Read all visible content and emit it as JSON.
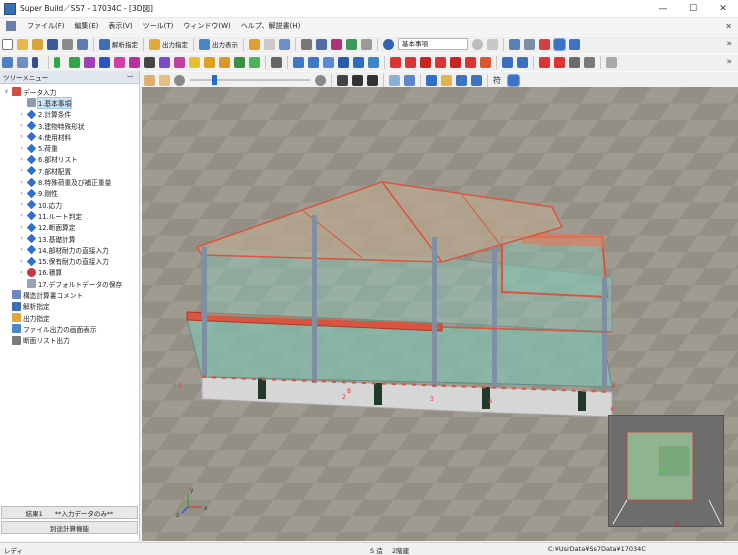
{
  "window": {
    "title": "Super Build／SS7 - 17034C - [3D図]",
    "minimize": "—",
    "maximize": "☐",
    "close": "✕"
  },
  "menu": {
    "items": [
      "ファイル(F)",
      "編集(E)",
      "表示(V)",
      "ツール(T)",
      "ウィンドウ(W)",
      "ヘルプ、解説書(H)"
    ],
    "close_mark": "✕"
  },
  "toolbar1": {
    "analysis_label": "解析指定",
    "output_spec_label": "出力指定",
    "output_view_label": "出力表示",
    "dropdown_value": "基本事項",
    "overflow": "»"
  },
  "toolbar3": {
    "text_tool": "符",
    "overflow": "»"
  },
  "tree": {
    "header": "ツリーメニュー",
    "pin": "ꟷ",
    "root": "データ入力",
    "items": [
      "1.基本事項",
      "2.計算条件",
      "3.建物特殊形状",
      "4.使用材料",
      "5.荷重",
      "6.部材リスト",
      "7.部材配置",
      "8.特殊荷重及び補正重量",
      "9.剛性",
      "10.応力",
      "11.ルート判定",
      "12.断面算定",
      "13.基礎計算",
      "14.部材耐力の直接入力",
      "15.保有耐力の直接入力",
      "16.積算",
      "17.デフォルトデータの保存"
    ],
    "others": [
      "構造計算書コメント",
      "解析指定",
      "出力指定",
      "ファイル出力の画面表示",
      "断面リスト出力"
    ]
  },
  "sidebar_footer": {
    "result_label": "結果1",
    "result_value": "**入力データのみ**",
    "calc_button": "別途計算機能"
  },
  "viewport": {
    "axis_x": "x",
    "axis_y": "y",
    "axis_z": "z",
    "grid_labels": [
      "1",
      "2",
      "3",
      "4",
      "A",
      "B",
      "2"
    ]
  },
  "status": {
    "ready": "レディ",
    "floor": "S 造",
    "stories": "2階建",
    "path": "C:¥UsrData¥Ss7Data¥17034C"
  },
  "colors": {
    "viewport_bg": "#9b968c",
    "floor_glass": "#7fc4b3",
    "beam_red": "#d9553f",
    "column": "#7f8fa3",
    "roof": "#b9a78f"
  }
}
